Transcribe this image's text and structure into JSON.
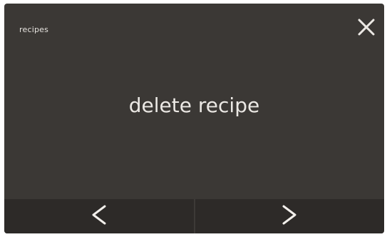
{
  "header": {
    "title": "recipes",
    "close_icon": "close-icon"
  },
  "main": {
    "message": "delete recipe"
  },
  "footer": {
    "prev_icon": "chevron-left-icon",
    "next_icon": "chevron-right-icon"
  },
  "colors": {
    "background": "#3b3835",
    "footer_background": "#2d2a28",
    "text": "#ebe8e4"
  }
}
